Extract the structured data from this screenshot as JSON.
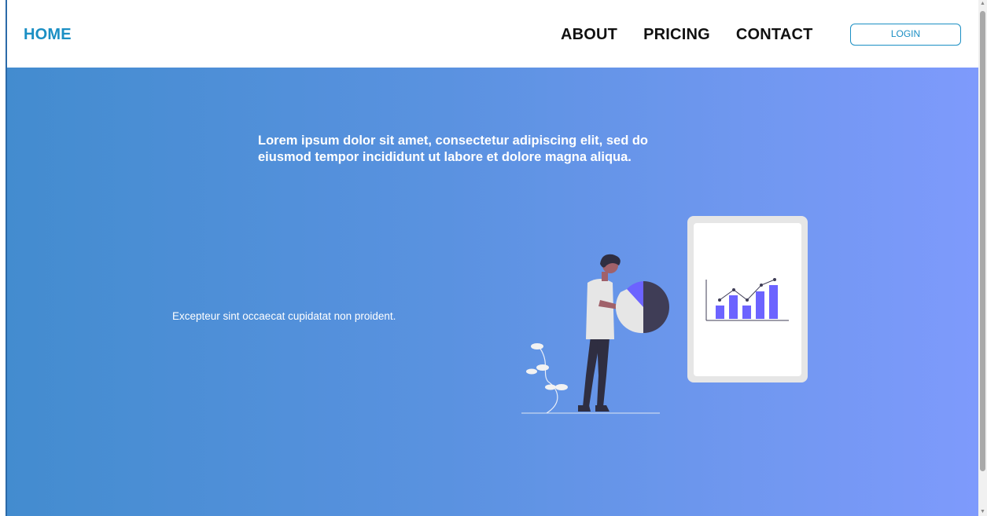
{
  "navbar": {
    "home_label": "HOME",
    "links": [
      {
        "label": "ABOUT"
      },
      {
        "label": "PRICING"
      },
      {
        "label": "CONTACT"
      }
    ],
    "login_label": "LOGIN"
  },
  "hero": {
    "headline": "Lorem ipsum dolor sit amet, consectetur adipiscing elit, sed do eiusmod tempor incididunt ut labore et dolore magna aliqua.",
    "subtext": "Excepteur sint occaecat cupidatat non proident.",
    "illustration": "person-with-pie-chart-and-tablet-bar-chart-illustration"
  },
  "colors": {
    "brand": "#1b8fc4",
    "gradient_start": "#438ccf",
    "gradient_end": "#7e9afc",
    "chart_accent": "#6c63ff",
    "chart_dark": "#3f3d56"
  },
  "scrollbar": {
    "up_icon": "chevron-up-icon",
    "down_icon": "chevron-down-icon"
  }
}
